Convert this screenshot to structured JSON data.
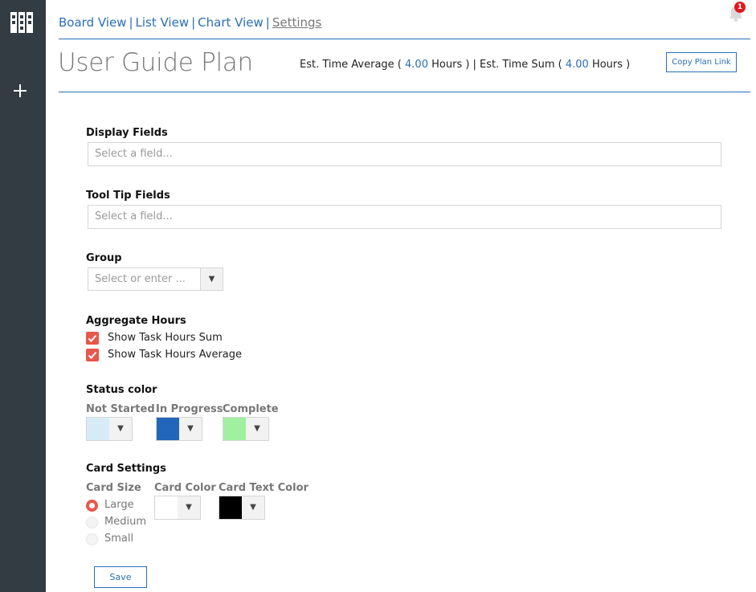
{
  "nav": {
    "board_view": "Board View",
    "list_view": "List View",
    "chart_view": "Chart View",
    "settings": "Settings",
    "separator": "|"
  },
  "notification": {
    "count": "1",
    "icon": "bell-icon"
  },
  "header": {
    "title": "User Guide Plan",
    "est_avg_prefix": "Est. Time Average (",
    "est_avg_value": "4.00",
    "est_avg_suffix": "Hours ) | Est. Time Sum (",
    "est_sum_value": "4.00",
    "est_sum_suffix": "Hours )",
    "copy_link_label": "Copy Plan Link"
  },
  "form": {
    "display_fields": {
      "label": "Display Fields",
      "placeholder": "Select a field..."
    },
    "tooltip_fields": {
      "label": "Tool Tip Fields",
      "placeholder": "Select a field..."
    },
    "group": {
      "label": "Group",
      "placeholder": "Select or enter ..."
    },
    "aggregate": {
      "label": "Aggregate Hours",
      "show_sum": {
        "label": "Show Task Hours Sum",
        "checked": true
      },
      "show_avg": {
        "label": "Show Task Hours Average",
        "checked": true
      }
    },
    "status_color": {
      "label": "Status color",
      "not_started": {
        "label": "Not Started",
        "color": "#d6ebf5"
      },
      "in_progress": {
        "label": "In Progress",
        "color": "#2266bb"
      },
      "complete": {
        "label": "Complete",
        "color": "#a0f0a0"
      }
    },
    "card_settings": {
      "label": "Card Settings",
      "card_size": {
        "label": "Card Size",
        "options": [
          "Large",
          "Medium",
          "Small"
        ],
        "selected": "Large"
      },
      "card_color": {
        "label": "Card Color",
        "color": "#ffffff"
      },
      "card_text_color": {
        "label": "Card Text Color",
        "color": "#000000"
      }
    },
    "save_label": "Save"
  },
  "colors": {
    "accent": "#2a6eb8",
    "checkbox": "#e8574a",
    "sidebar": "#333c42"
  }
}
